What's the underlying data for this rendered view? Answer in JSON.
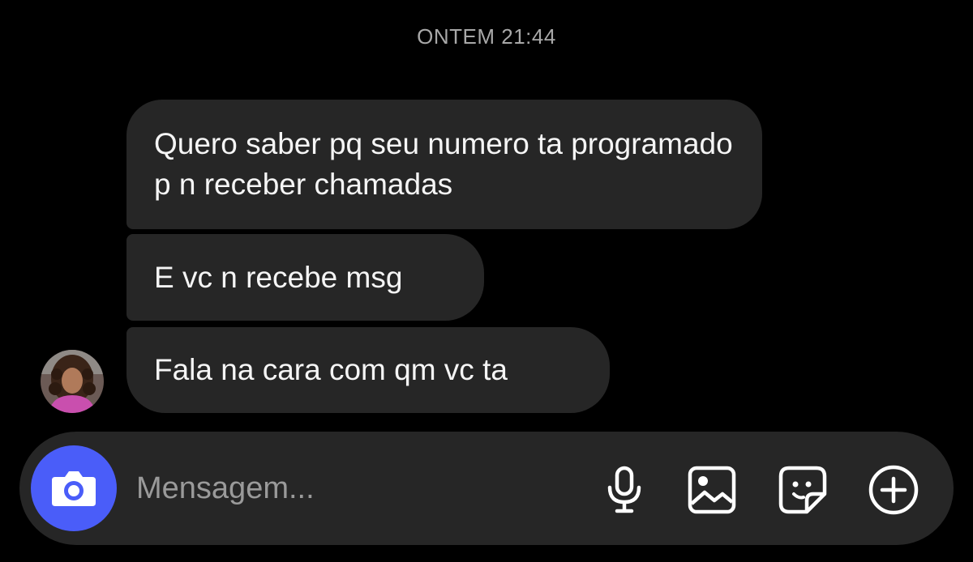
{
  "timestamp": "ONTEM 21:44",
  "messages": [
    {
      "text": "Quero saber pq seu numero ta programado p n receber chamadas"
    },
    {
      "text": "E vc n recebe msg"
    },
    {
      "text": "Fala na cara com qm vc ta"
    }
  ],
  "composer": {
    "placeholder": "Mensagem...",
    "icons": [
      "camera-icon",
      "microphone-icon",
      "gallery-icon",
      "sticker-icon",
      "plus-circle-icon"
    ]
  },
  "colors": {
    "background": "#000000",
    "bubble": "#262626",
    "accent": "#4a5df9",
    "timestamp": "#a8a8a8",
    "placeholder": "#9a9a9a"
  }
}
